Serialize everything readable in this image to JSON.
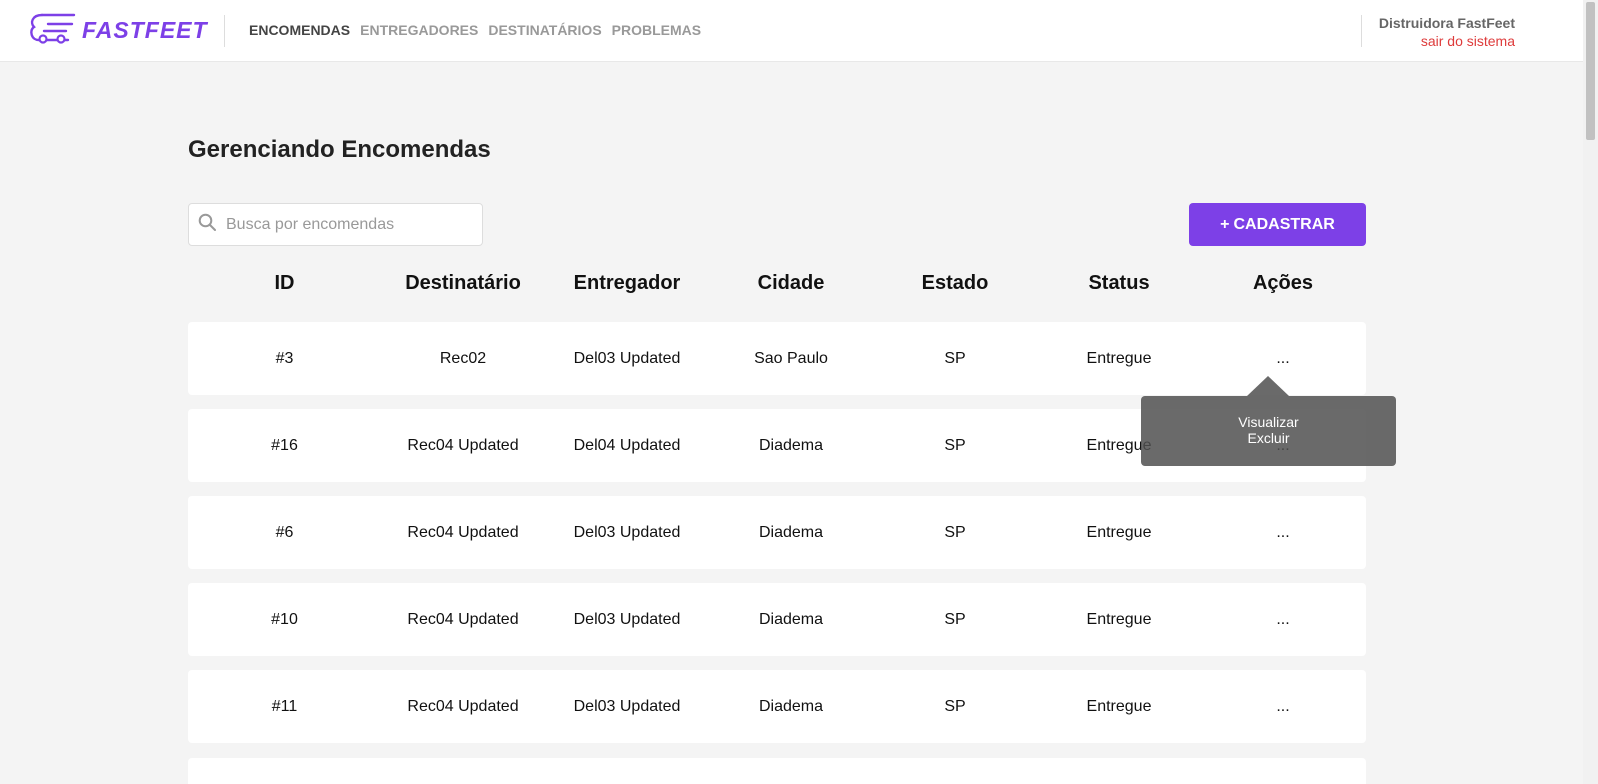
{
  "brand": {
    "name": "FASTFEET",
    "color": "#7d40e7",
    "icon": "truck-speed-lines-icon"
  },
  "nav": {
    "items": [
      {
        "label": "ENCOMENDAS",
        "active": true
      },
      {
        "label": "ENTREGADORES",
        "active": false
      },
      {
        "label": "DESTINATÁRIOS",
        "active": false
      },
      {
        "label": "PROBLEMAS",
        "active": false
      }
    ]
  },
  "profile": {
    "name": "Distruidora FastFeet",
    "logout_label": "sair do sistema",
    "logout_color": "#de3b3b"
  },
  "page": {
    "title": "Gerenciando Encomendas"
  },
  "search": {
    "placeholder": "Busca por encomendas",
    "value": "",
    "icon": "search-icon"
  },
  "add_button": {
    "icon": "+",
    "label": "CADASTRAR"
  },
  "table": {
    "columns": [
      "ID",
      "Destinatário",
      "Entregador",
      "Cidade",
      "Estado",
      "Status",
      "Ações"
    ],
    "rows": [
      {
        "id": "#3",
        "recipient": "Rec02",
        "deliveryman": "Del03 Updated",
        "city": "Sao Paulo",
        "state": "SP",
        "status": "Entregue",
        "actions": "..."
      },
      {
        "id": "#16",
        "recipient": "Rec04 Updated",
        "deliveryman": "Del04 Updated",
        "city": "Diadema",
        "state": "SP",
        "status": "Entregue",
        "actions": "..."
      },
      {
        "id": "#6",
        "recipient": "Rec04 Updated",
        "deliveryman": "Del03 Updated",
        "city": "Diadema",
        "state": "SP",
        "status": "Entregue",
        "actions": "..."
      },
      {
        "id": "#10",
        "recipient": "Rec04 Updated",
        "deliveryman": "Del03 Updated",
        "city": "Diadema",
        "state": "SP",
        "status": "Entregue",
        "actions": "..."
      },
      {
        "id": "#11",
        "recipient": "Rec04 Updated",
        "deliveryman": "Del03 Updated",
        "city": "Diadema",
        "state": "SP",
        "status": "Entregue",
        "actions": "..."
      }
    ]
  },
  "actions_menu": {
    "items": [
      "Visualizar",
      "Excluir"
    ]
  }
}
